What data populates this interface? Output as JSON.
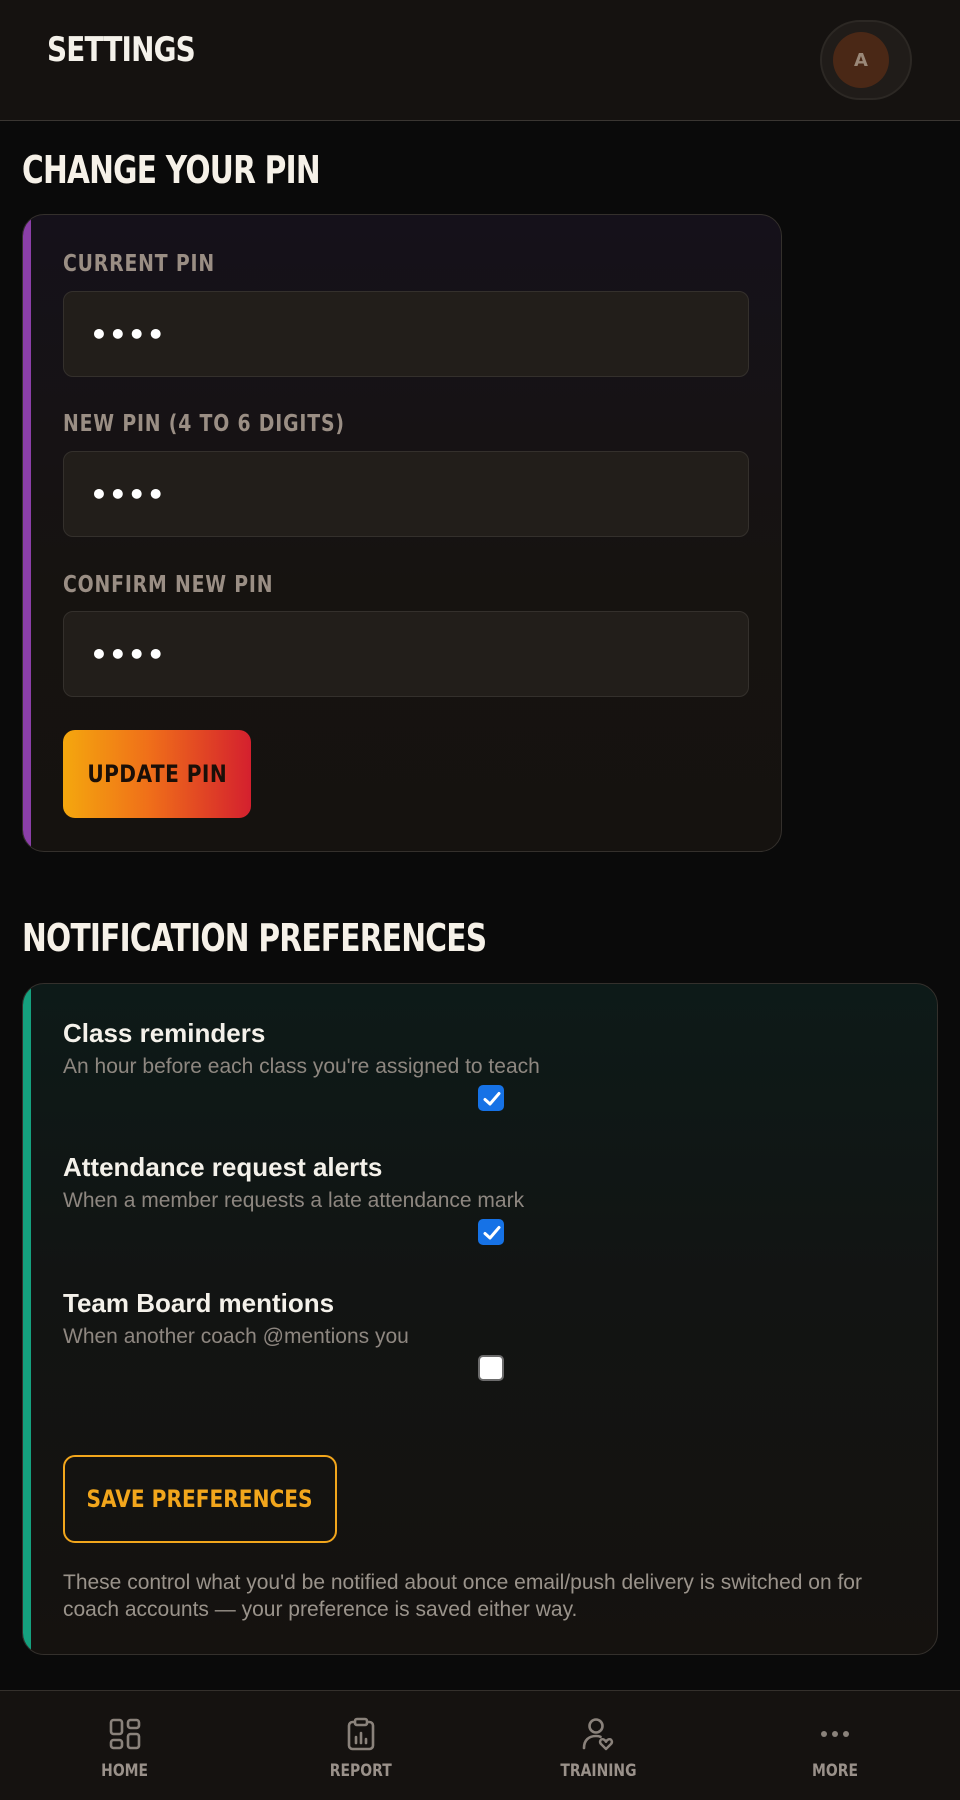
{
  "header": {
    "title": "SETTINGS",
    "avatar_initial": "A"
  },
  "pin_section": {
    "title": "CHANGE YOUR PIN",
    "accent_color": "#8b3fa8",
    "fields": [
      {
        "label": "CURRENT PIN",
        "value": "1234"
      },
      {
        "label": "NEW PIN (4 TO 6 DIGITS)",
        "value": "1234"
      },
      {
        "label": "CONFIRM NEW PIN",
        "value": "1234"
      }
    ],
    "submit_label": "UPDATE PIN"
  },
  "notification_section": {
    "title": "NOTIFICATION PREFERENCES",
    "accent_color": "#15a07e",
    "preferences": [
      {
        "title": "Class reminders",
        "description": "An hour before each class you're assigned to teach",
        "checked": true
      },
      {
        "title": "Attendance request alerts",
        "description": "When a member requests a late attendance mark",
        "checked": true
      },
      {
        "title": "Team Board mentions",
        "description": "When another coach @mentions you",
        "checked": false
      }
    ],
    "save_label": "SAVE PREFERENCES",
    "footnote": "These control what you'd be notified about once email/push delivery is switched on for coach accounts — your preference is saved either way."
  },
  "bottom_nav": {
    "items": [
      {
        "label": "HOME",
        "icon": "grid-icon"
      },
      {
        "label": "REPORT",
        "icon": "clipboard-icon"
      },
      {
        "label": "TRAINING",
        "icon": "user-heart-icon"
      },
      {
        "label": "MORE",
        "icon": "more-dots-icon"
      }
    ]
  },
  "colors": {
    "primary_gradient_start": "#f4a70e",
    "primary_gradient_end": "#d4202e",
    "outline_button": "#f2a61c",
    "checkbox_on": "#1672e6"
  }
}
